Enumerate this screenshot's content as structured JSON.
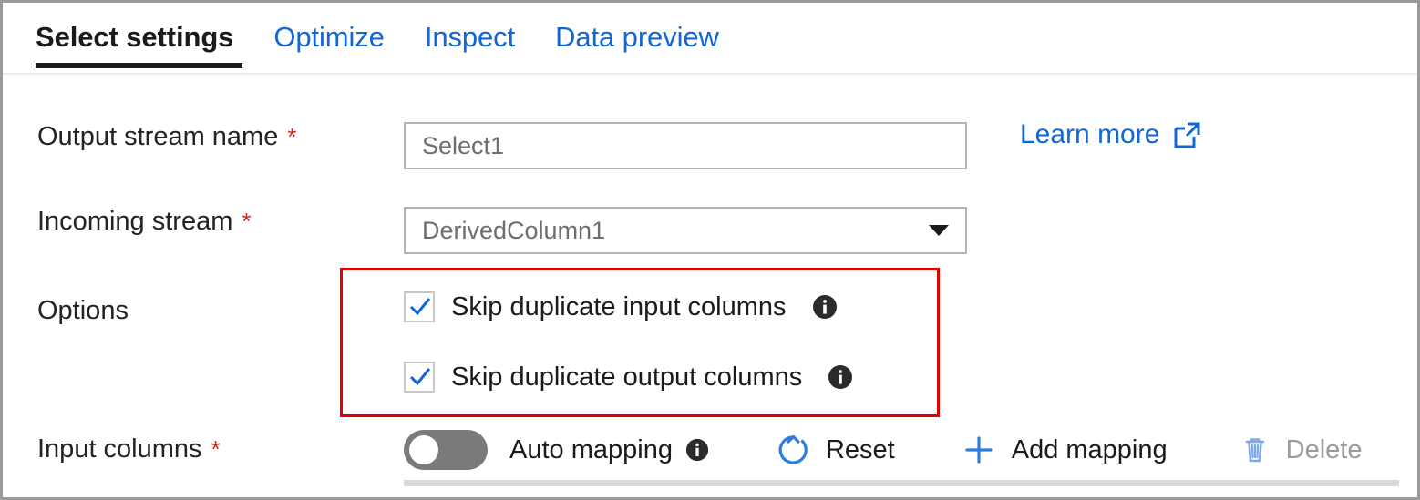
{
  "tabs": [
    {
      "label": "Select settings",
      "active": true
    },
    {
      "label": "Optimize",
      "active": false
    },
    {
      "label": "Inspect",
      "active": false
    },
    {
      "label": "Data preview",
      "active": false
    }
  ],
  "fields": {
    "output_stream": {
      "label": "Output stream name",
      "required_marker": "*",
      "value": "Select1",
      "placeholder": "Select1"
    },
    "incoming_stream": {
      "label": "Incoming stream",
      "required_marker": "*",
      "value": "DerivedColumn1"
    },
    "options": {
      "label": "Options",
      "checkboxes": [
        {
          "label": "Skip duplicate input columns",
          "checked": true
        },
        {
          "label": "Skip duplicate output columns",
          "checked": true
        }
      ]
    },
    "input_columns": {
      "label": "Input columns",
      "required_marker": "*"
    }
  },
  "links": {
    "learn_more": "Learn more"
  },
  "toolbar": {
    "auto_mapping_label": "Auto mapping",
    "auto_mapping_on": false,
    "reset_label": "Reset",
    "add_mapping_label": "Add mapping",
    "delete_label": "Delete",
    "delete_enabled": false
  },
  "icons": {
    "external_link": "external-link-icon",
    "chevron_down": "chevron-down-icon",
    "info": "info-icon",
    "check": "check-icon",
    "reset": "reset-icon",
    "plus": "plus-icon",
    "trash": "trash-icon"
  },
  "colors": {
    "link_blue": "#1267d6",
    "accent_blue": "#3b7fe0",
    "required_red": "#c42b1c",
    "highlight_red": "#e00000",
    "text_dark": "#1b1b1b",
    "text_muted": "#6e6e6e",
    "disabled_gray": "#9b9b9b",
    "border_gray": "#b4b4b4",
    "toggle_off_gray": "#7a7a7a"
  }
}
